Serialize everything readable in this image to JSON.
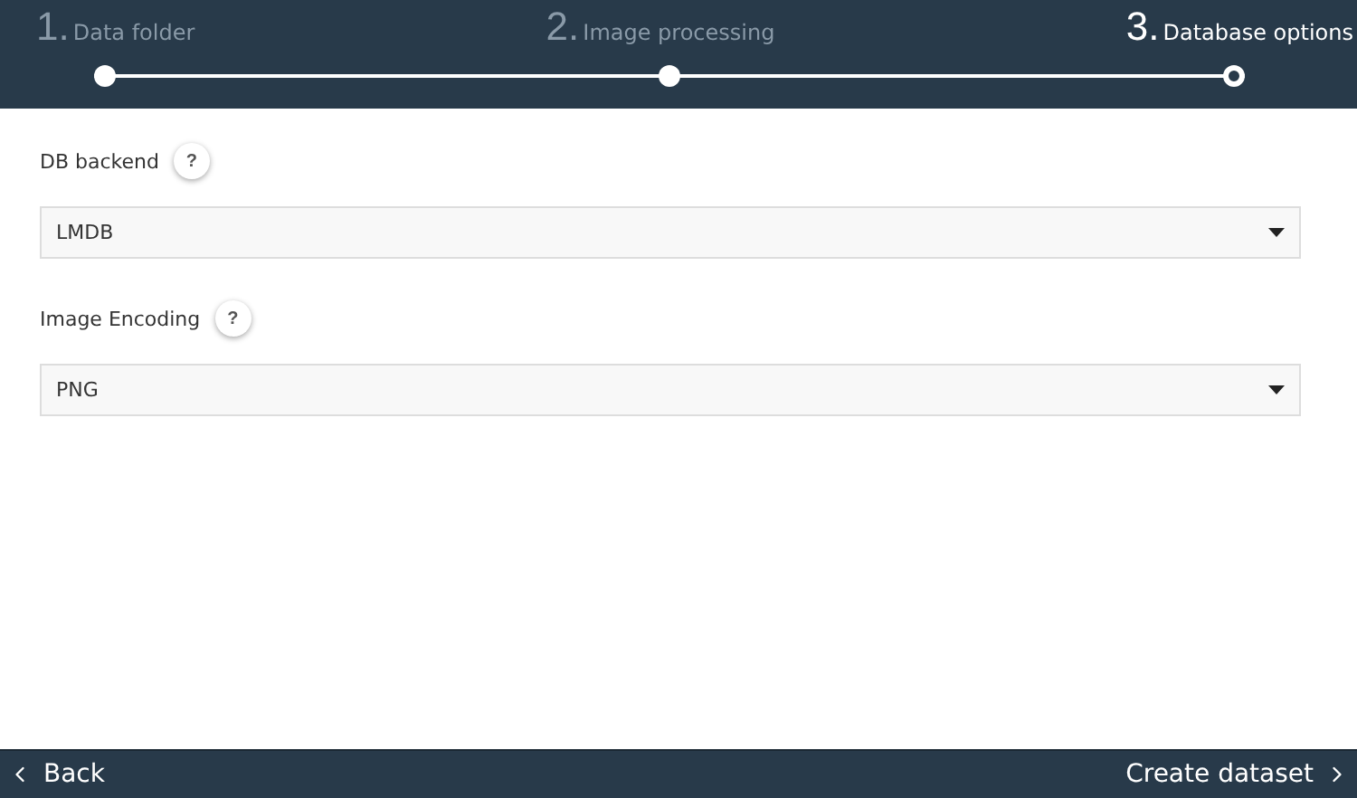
{
  "steps": [
    {
      "number": "1.",
      "label": "Data folder",
      "selected": false
    },
    {
      "number": "2.",
      "label": "Image processing",
      "selected": false
    },
    {
      "number": "3.",
      "label": "Database options",
      "selected": true
    }
  ],
  "fields": [
    {
      "label": "DB backend",
      "help": "?",
      "value": "LMDB"
    },
    {
      "label": "Image Encoding",
      "help": "?",
      "value": "PNG"
    }
  ],
  "footer": {
    "back": "Back",
    "next": "Create dataset"
  }
}
